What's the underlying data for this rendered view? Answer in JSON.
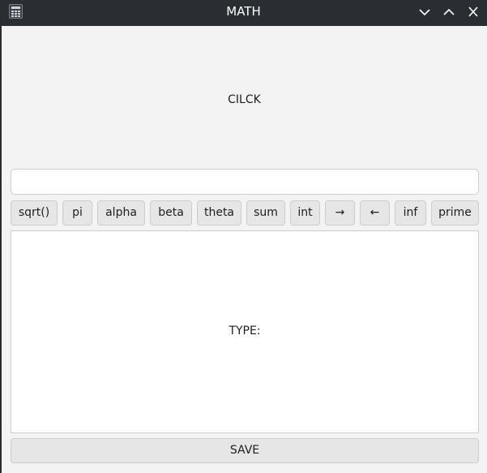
{
  "window": {
    "title": "MATH",
    "app_icon": "calculator-icon",
    "controls": [
      "minimize-icon",
      "maximize-icon",
      "close-icon"
    ]
  },
  "main": {
    "click_label": "CILCK",
    "input": {
      "value": "",
      "placeholder": ""
    },
    "buttons": [
      "sqrt()",
      "pi",
      "alpha",
      "beta",
      "theta",
      "sum",
      "int",
      "→",
      "←",
      "inf",
      "prime"
    ],
    "type_label": "TYPE:",
    "save_label": "SAVE"
  }
}
